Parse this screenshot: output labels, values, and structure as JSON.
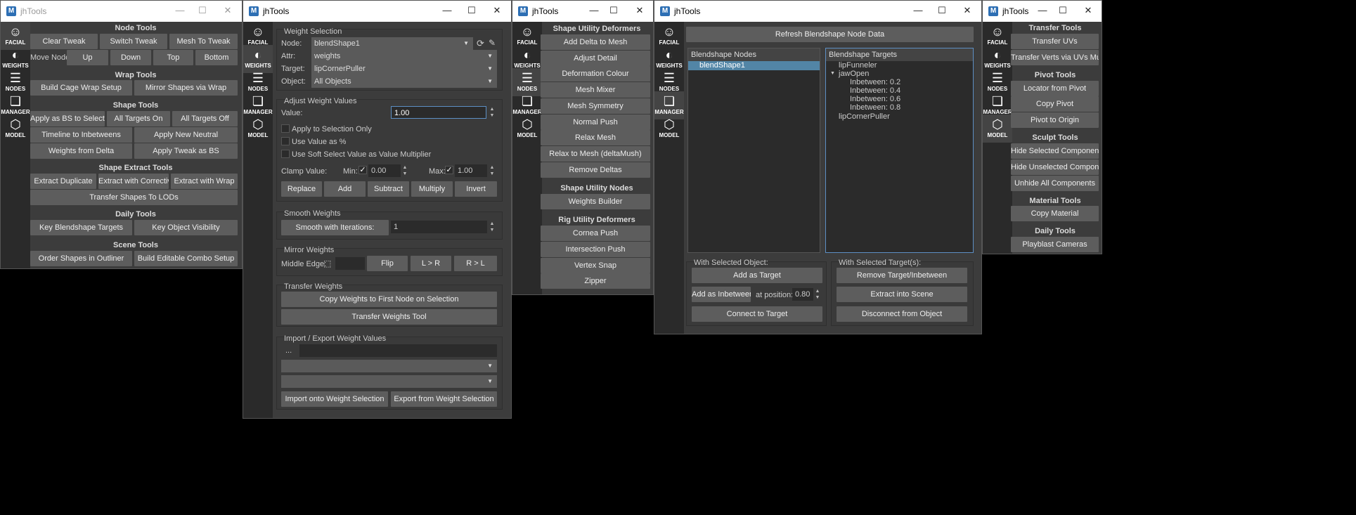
{
  "app_title": "jhTools",
  "app_icon": "M",
  "window_controls": {
    "min": "—",
    "max": "☐",
    "close": "✕"
  },
  "sidebar": [
    {
      "label": "FACIAL",
      "icon": "face-icon",
      "glyph": "☺"
    },
    {
      "label": "WEIGHTS",
      "icon": "weights-icon",
      "glyph": "◐"
    },
    {
      "label": "NODES",
      "icon": "nodes-icon",
      "glyph": "☰"
    },
    {
      "label": "MANAGER",
      "icon": "manager-icon",
      "glyph": "❏"
    },
    {
      "label": "MODEL",
      "icon": "cube-icon",
      "glyph": "⬡"
    }
  ],
  "w1": {
    "node_tools": "Node Tools",
    "clear_tweak": "Clear Tweak",
    "switch_tweak": "Switch Tweak",
    "mesh_to_tweak": "Mesh To Tweak",
    "move_node": "Move Node:",
    "up": "Up",
    "down": "Down",
    "top": "Top",
    "bottom": "Bottom",
    "wrap_tools": "Wrap Tools",
    "build_cage": "Build Cage Wrap Setup",
    "mirror_wrap": "Mirror Shapes via Wrap",
    "shape_tools": "Shape Tools",
    "apply_bs": "Apply as BS to Selection",
    "all_on": "All Targets On",
    "all_off": "All Targets Off",
    "timeline": "Timeline to Inbetweens",
    "apply_neutral": "Apply New Neutral",
    "weights_delta": "Weights from Delta",
    "apply_tweak": "Apply Tweak as BS",
    "shape_extract": "Shape Extract Tools",
    "extract_dup": "Extract Duplicate",
    "extract_corr": "Extract with Corrective",
    "extract_wrap": "Extract with Wrap",
    "transfer_lods": "Transfer Shapes To LODs",
    "daily": "Daily Tools",
    "key_bs": "Key Blendshape Targets",
    "key_vis": "Key Object Visibility",
    "scene": "Scene Tools",
    "order": "Order Shapes in Outliner",
    "combo": "Build Editable Combo Setup"
  },
  "w2": {
    "weight_selection": "Weight Selection",
    "node_lbl": "Node:",
    "node_val": "blendShape1",
    "attr_lbl": "Attr:",
    "attr_val": "weights",
    "target_lbl": "Target:",
    "target_val": "lipCornerPuller",
    "object_lbl": "Object:",
    "object_val": "All Objects",
    "adjust": "Adjust Weight Values",
    "value_lbl": "Value:",
    "value_val": "1.00",
    "apply_sel": "Apply to Selection Only",
    "use_pct": "Use Value as %",
    "use_soft": "Use Soft Select Value as Value Multiplier",
    "clamp": "Clamp Value:",
    "min": "Min:",
    "min_val": "0.00",
    "max": "Max:",
    "max_val": "1.00",
    "replace": "Replace",
    "add": "Add",
    "subtract": "Subtract",
    "multiply": "Multiply",
    "invert": "Invert",
    "smooth": "Smooth Weights",
    "smooth_btn": "Smooth with Iterations:",
    "smooth_val": "1",
    "mirror": "Mirror Weights",
    "middle_edge": "Middle Edge:",
    "flip": "Flip",
    "l_r": "L > R",
    "r_l": "R > L",
    "transfer": "Transfer Weights",
    "copy_first": "Copy Weights to First Node on Selection",
    "transfer_tool": "Transfer Weights Tool",
    "import_export": "Import / Export Weight Values",
    "dots": "...",
    "import_btn": "Import onto Weight Selection",
    "export_btn": "Export from Weight Selection"
  },
  "w3": {
    "shape_def": "Shape Utility Deformers",
    "add_delta": "Add Delta to Mesh",
    "adjust_detail": "Adjust Detail",
    "deform_colour": "Deformation Colour",
    "mesh_mixer": "Mesh Mixer",
    "mesh_sym": "Mesh Symmetry",
    "normal_push": "Normal Push",
    "relax": "Relax Mesh",
    "relax_delta": "Relax to Mesh (deltaMush)",
    "remove_deltas": "Remove Deltas",
    "shape_nodes": "Shape Utility Nodes",
    "weights_builder": "Weights Builder",
    "rig_def": "Rig Utility Deformers",
    "cornea": "Cornea Push",
    "intersection": "Intersection Push",
    "vertex_snap": "Vertex Snap",
    "zipper": "Zipper"
  },
  "w4": {
    "refresh": "Refresh Blendshape Node Data",
    "nodes_hdr": "Blendshape Nodes",
    "node_item": "blendShape1",
    "targets_hdr": "Blendshape Targets",
    "targets": [
      "lipFunneler",
      "jawOpen",
      "Inbetween: 0.2",
      "Inbetween: 0.4",
      "Inbetween: 0.6",
      "Inbetween: 0.8",
      "lipCornerPuller"
    ],
    "expander": "▼",
    "with_obj": "With Selected Object:",
    "add_target": "Add as Target",
    "add_inbetween": "Add as Inbetween",
    "at_pos": "at position:",
    "pos_val": "0.80",
    "connect": "Connect to Target",
    "with_targets": "With Selected Target(s):",
    "remove": "Remove Target/Inbetween",
    "extract_scene": "Extract into Scene",
    "disconnect": "Disconnect from Object"
  },
  "w5": {
    "transfer_tools": "Transfer Tools",
    "transfer_uvs": "Transfer UVs",
    "transfer_verts": "Transfer Verts via UVs Multi",
    "pivot_tools": "Pivot Tools",
    "locator": "Locator from Pivot",
    "copy_pivot": "Copy Pivot",
    "pivot_origin": "Pivot to Origin",
    "sculpt": "Sculpt Tools",
    "hide_sel": "Hide Selected Components",
    "hide_unsel": "Hide Unselected Components",
    "unhide": "Unhide All Components",
    "material": "Material Tools",
    "copy_mat": "Copy Material",
    "daily": "Daily Tools",
    "playblast": "Playblast Cameras"
  }
}
